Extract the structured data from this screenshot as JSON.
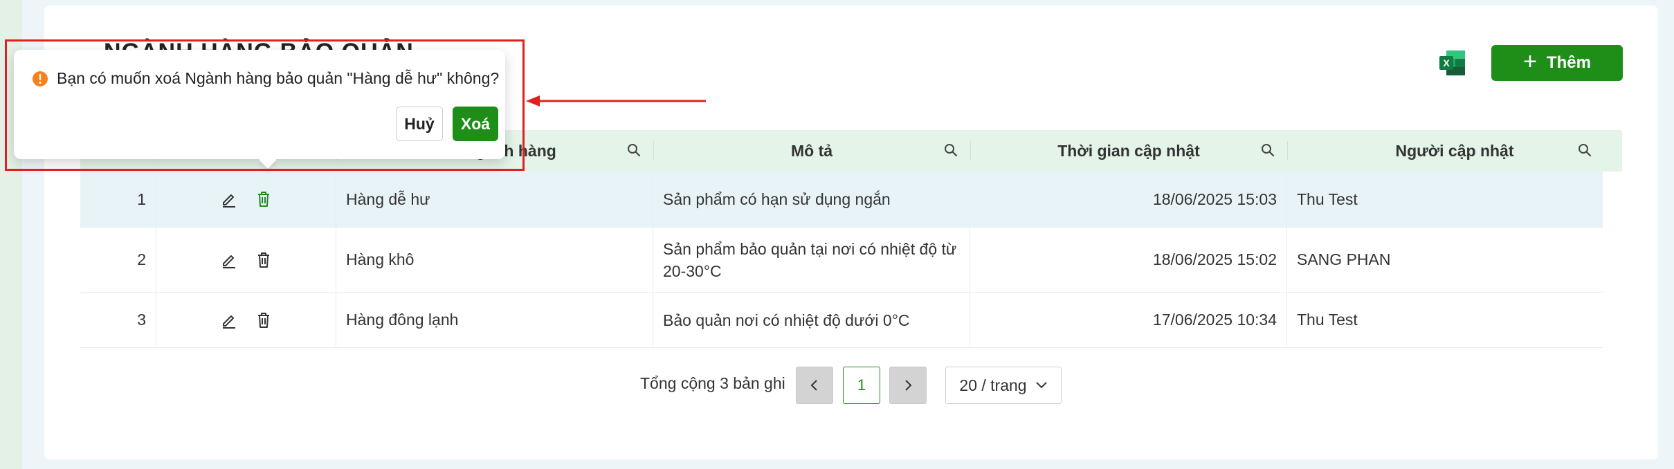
{
  "page": {
    "title": "NGÀNH HÀNG BẢO QUẢN"
  },
  "toolbar": {
    "add_label": "Thêm",
    "excel_icon": "excel-icon",
    "add_icon": "plus-icon"
  },
  "colors": {
    "primary": "#1f8e18",
    "header_bg": "#e4f4e8",
    "row_highlight": "#e8f3f8",
    "warning": "#f5821f",
    "annotation": "#e02020"
  },
  "table": {
    "columns": [
      {
        "key": "stt",
        "label": ""
      },
      {
        "key": "actions",
        "label": ""
      },
      {
        "key": "name",
        "label": "Tên ngành hàng"
      },
      {
        "key": "desc",
        "label": "Mô tả"
      },
      {
        "key": "time",
        "label": "Thời gian cập nhật"
      },
      {
        "key": "user",
        "label": "Người cập nhật"
      }
    ],
    "rows": [
      {
        "stt": "1",
        "name": "Hàng dễ hư",
        "desc": "Sản phẩm có hạn sử dụng ngắn",
        "time": "18/06/2025 15:03",
        "user": "Thu Test"
      },
      {
        "stt": "2",
        "name": "Hàng khô",
        "desc": "Sản phẩm bảo quản tại nơi có nhiệt độ từ 20-30°C",
        "time": "18/06/2025 15:02",
        "user": "SANG PHAN"
      },
      {
        "stt": "3",
        "name": "Hàng đông lạnh",
        "desc": "Bảo quản nơi có nhiệt độ dưới 0°C",
        "time": "17/06/2025 10:34",
        "user": "Thu Test"
      }
    ]
  },
  "pagination": {
    "total_text": "Tổng cộng 3 bản ghi",
    "current_page": "1",
    "page_size": "20 / trang"
  },
  "popconfirm": {
    "message": "Bạn có muốn xoá Ngành hàng bảo quản \"Hàng dễ hư\" không?",
    "cancel_label": "Huỷ",
    "ok_label": "Xoá"
  }
}
